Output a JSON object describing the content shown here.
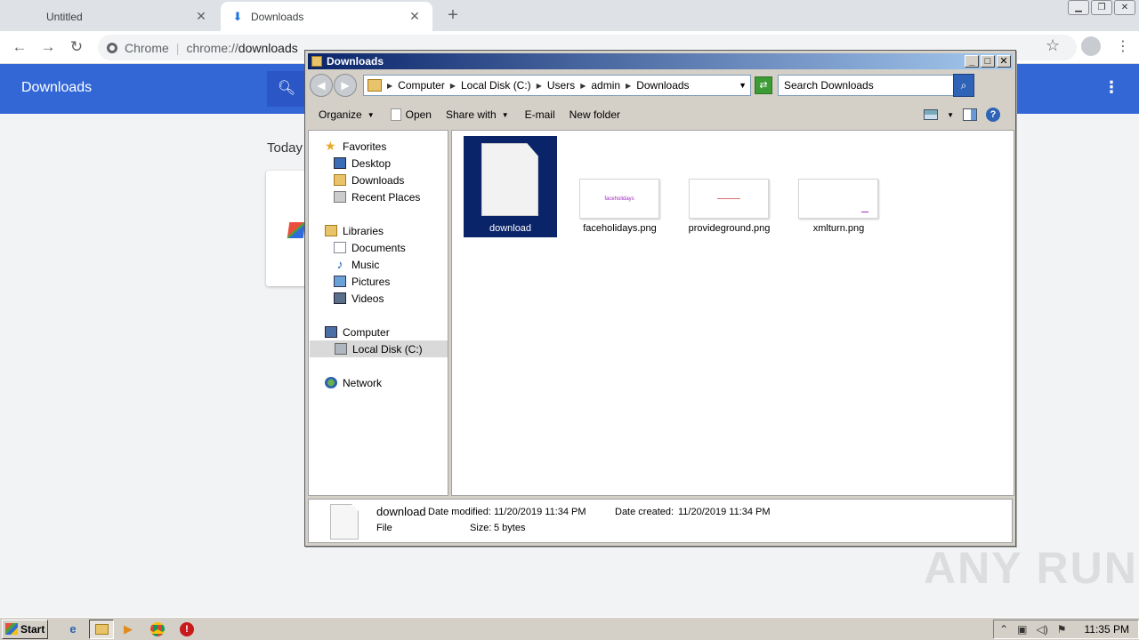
{
  "browser": {
    "tabs": [
      {
        "label": "Untitled"
      },
      {
        "label": "Downloads"
      }
    ],
    "omnibox": {
      "site": "Chrome",
      "url_scheme": "chrome://",
      "url_host": "downloads"
    },
    "page": {
      "header_title": "Downloads",
      "section_label": "Today"
    }
  },
  "explorer": {
    "title": "Downloads",
    "breadcrumbs": [
      "Computer",
      "Local Disk (C:)",
      "Users",
      "admin",
      "Downloads"
    ],
    "search_placeholder": "Search Downloads",
    "commands": {
      "organize": "Organize",
      "open": "Open",
      "share_with": "Share with",
      "email": "E-mail",
      "new_folder": "New folder"
    },
    "nav": {
      "favorites": "Favorites",
      "desktop": "Desktop",
      "downloads": "Downloads",
      "recent_places": "Recent Places",
      "libraries": "Libraries",
      "documents": "Documents",
      "music": "Music",
      "pictures": "Pictures",
      "videos": "Videos",
      "computer": "Computer",
      "local_disk": "Local Disk (C:)",
      "network": "Network"
    },
    "files": [
      {
        "name": "download",
        "selected": true
      },
      {
        "name": "faceholidays.png",
        "thumb_text": "faceholidays"
      },
      {
        "name": "provideground.png"
      },
      {
        "name": "xmlturn.png"
      }
    ],
    "details": {
      "name": "download",
      "type": "File",
      "date_modified_label": "Date modified:",
      "date_modified": "11/20/2019 11:34 PM",
      "date_created_label": "Date created:",
      "date_created": "11/20/2019 11:34 PM",
      "size_label": "Size:",
      "size": "5 bytes"
    }
  },
  "taskbar": {
    "start_label": "Start",
    "clock": "11:35 PM"
  },
  "watermark": "ANY RUN",
  "colors": {
    "chrome_header": "#3367d6",
    "selection": "#0a246a"
  }
}
